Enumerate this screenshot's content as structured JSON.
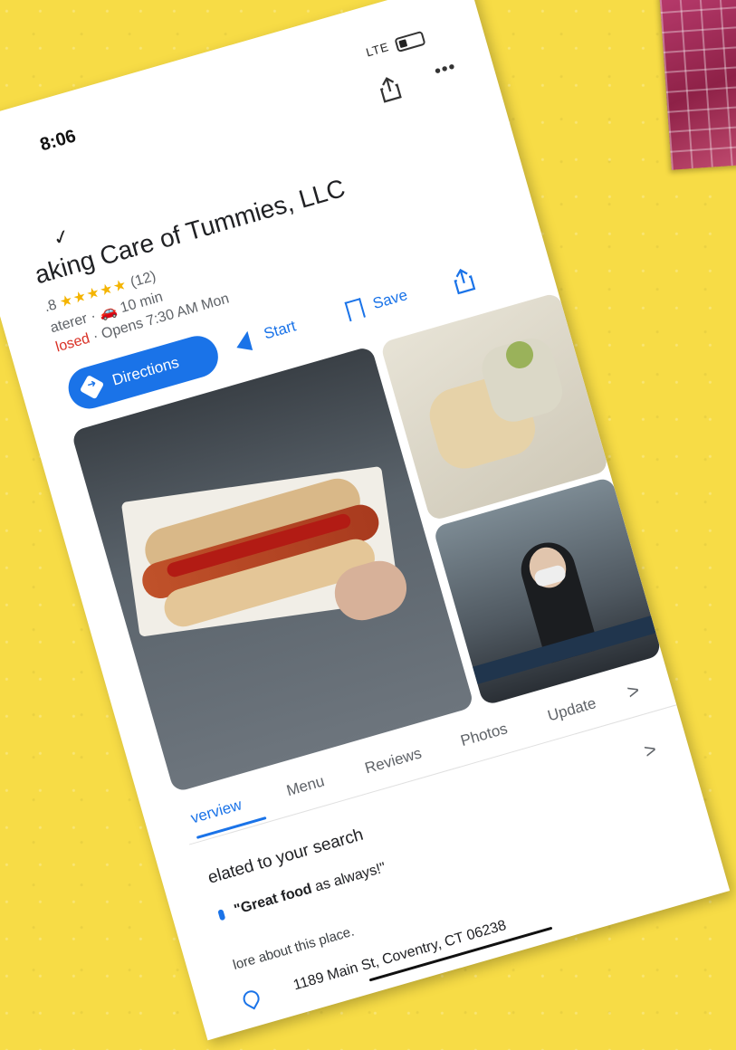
{
  "status": {
    "time": "8:06",
    "signal_text": "LTE"
  },
  "header": {
    "back_mark": "✓",
    "more_label": "•••"
  },
  "place": {
    "title": "aking Care of Tummies, LLC",
    "rating_prefix": ".8",
    "stars": "★★★★★",
    "review_count": "(12)",
    "category": "aterer",
    "drive_time": "10 min",
    "status_closed": "losed",
    "hours_text": "· Opens 7:30 AM Mon"
  },
  "actions": {
    "directions_label": "Directions",
    "start_label": "Start",
    "save_label": "Save"
  },
  "tabs": [
    {
      "label": "verview"
    },
    {
      "label": "Menu"
    },
    {
      "label": "Reviews"
    },
    {
      "label": "Photos"
    },
    {
      "label": "Update"
    }
  ],
  "related": {
    "heading": "elated to your search",
    "quote_bold": "\"Great food",
    "quote_rest": " as always!\"",
    "more_about": "lore about this place."
  },
  "address": {
    "text": "1189 Main St, Coventry, CT 06238"
  },
  "chevron": ">"
}
